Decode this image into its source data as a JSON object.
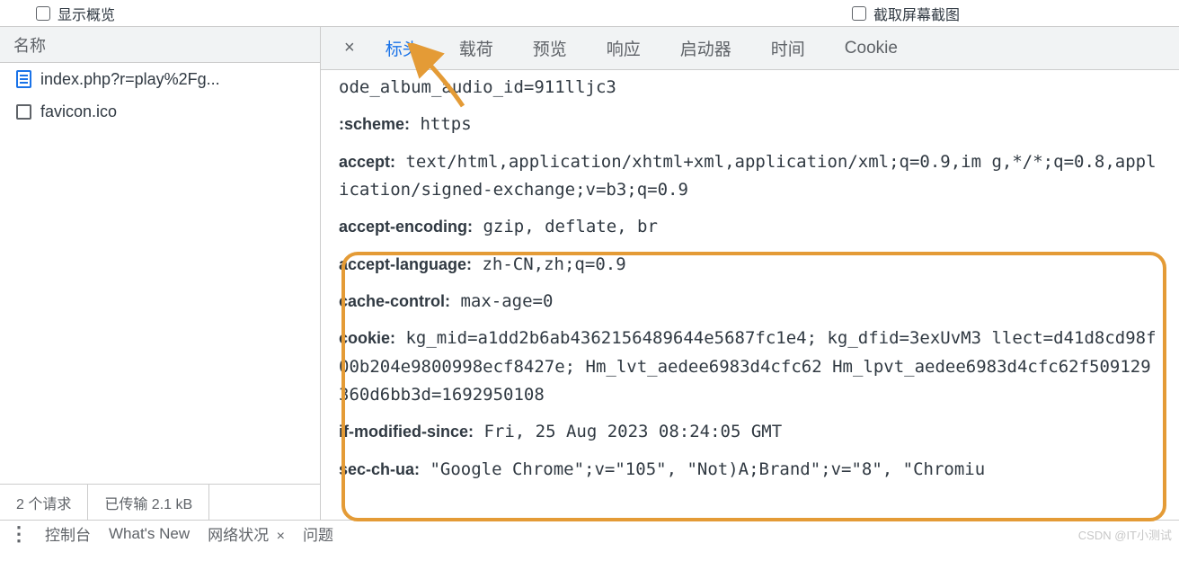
{
  "topbar": {
    "leftLabel": "显示概览",
    "rightLabel": "截取屏幕截图"
  },
  "leftPanel": {
    "header": "名称",
    "requests": [
      {
        "name": "index.php?r=play%2Fg...",
        "iconType": "doc"
      },
      {
        "name": "favicon.ico",
        "iconType": "img"
      }
    ],
    "footer": {
      "requestCount": "2 个请求",
      "transferred": "已传输 2.1 kB"
    }
  },
  "tabs": {
    "items": [
      "标头",
      "载荷",
      "预览",
      "响应",
      "启动器",
      "时间",
      "Cookie"
    ],
    "activeIndex": 0
  },
  "headers": {
    "line0": "ode_album_audio_id=911lljc3",
    "rows": [
      {
        "key": ":scheme:",
        "value": " https"
      },
      {
        "key": "accept:",
        "value": " text/html,application/xhtml+xml,application/xml;q=0.9,im g,*/*;q=0.8,application/signed-exchange;v=b3;q=0.9",
        "wrap": true
      },
      {
        "key": "accept-encoding:",
        "value": " gzip, deflate, br"
      },
      {
        "key": "accept-language:",
        "value": " zh-CN,zh;q=0.9"
      },
      {
        "key": "cache-control:",
        "value": " max-age=0"
      },
      {
        "key": "cookie:",
        "value": " kg_mid=a1dd2b6ab4362156489644e5687fc1e4; kg_dfid=3exUvM3 llect=d41d8cd98f00b204e9800998ecf8427e; Hm_lvt_aedee6983d4cfc62 Hm_lpvt_aedee6983d4cfc62f509129360d6bb3d=1692950108",
        "wrap": true
      },
      {
        "key": "if-modified-since:",
        "value": " Fri, 25 Aug 2023 08:24:05 GMT"
      },
      {
        "key": "sec-ch-ua:",
        "value": " \"Google Chrome\";v=\"105\", \"Not)A;Brand\";v=\"8\", \"Chromiu"
      }
    ]
  },
  "bottomBar": {
    "console": "控制台",
    "whatsNew": "What's New",
    "netStatus": "网络状况",
    "issues": "问题"
  },
  "watermark": "CSDN @IT小测试"
}
